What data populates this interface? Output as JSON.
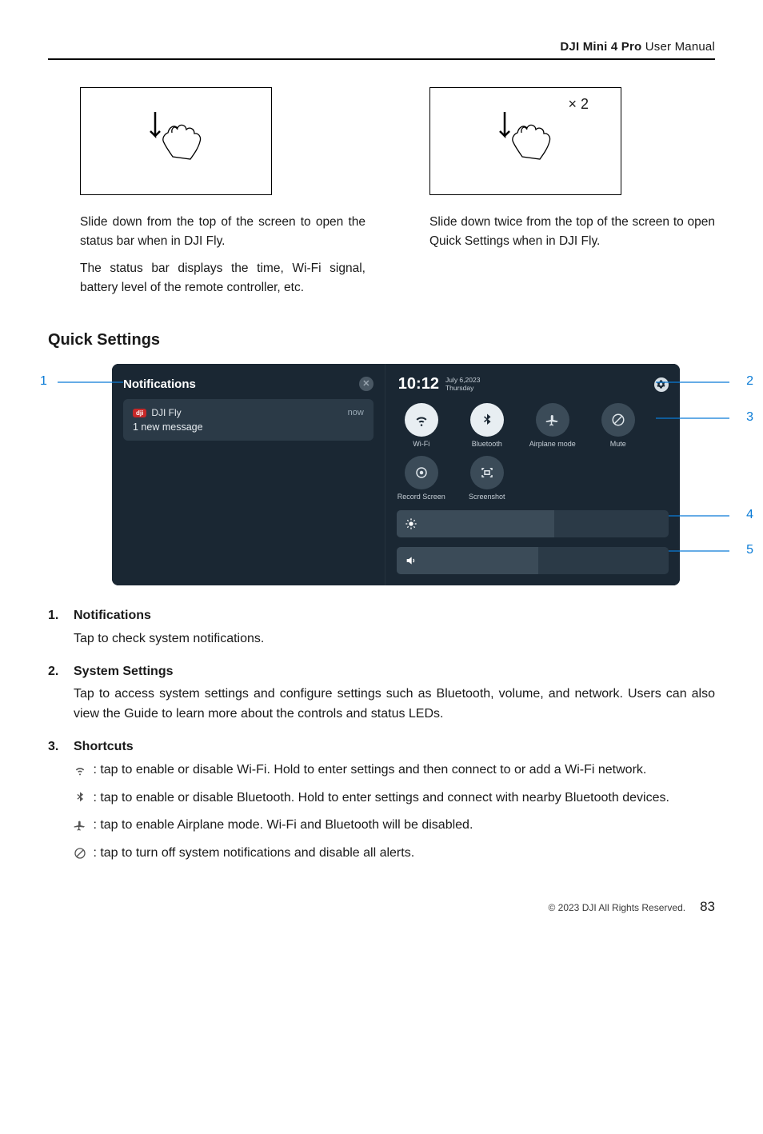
{
  "header": {
    "product": "DJI Mini 4 Pro",
    "suffix": " User Manual"
  },
  "gesture": {
    "left": {
      "p1": "Slide down from the top of the screen to open the status bar when in DJI Fly.",
      "p2": "The status bar displays the time, Wi-Fi signal, battery level of the remote controller, etc."
    },
    "right": {
      "x2": "× 2",
      "p1": "Slide down twice from the top of the screen to open Quick Settings when in DJI Fly."
    }
  },
  "section_title": "Quick Settings",
  "qs": {
    "notif_header": "Notifications",
    "notif_app": "DJI Fly",
    "notif_time": "now",
    "notif_msg": "1 new message",
    "time": "10:12",
    "date_line1": "July 6,2023",
    "date_line2": "Thursday",
    "toggles": {
      "wifi": "Wi-Fi",
      "bt": "Bluetooth",
      "air": "Airplane mode",
      "mute": "Mute",
      "rec": "Record Screen",
      "shot": "Screenshot"
    }
  },
  "callouts": {
    "c1": "1",
    "c2": "2",
    "c3": "3",
    "c4": "4",
    "c5": "5"
  },
  "items": [
    {
      "n": "1.",
      "title": "Notifications",
      "desc": "Tap to check system notifications."
    },
    {
      "n": "2.",
      "title": "System Settings",
      "desc": "Tap to access system settings and configure settings such as Bluetooth, volume, and network. Users can also view the Guide to learn more about the controls and status LEDs."
    },
    {
      "n": "3.",
      "title": "Shortcuts",
      "wifi": " : tap to enable or disable Wi-Fi. Hold to enter settings and then connect to or add a Wi-Fi network.",
      "bt": " : tap to enable or disable Bluetooth. Hold to enter settings and connect with nearby Bluetooth devices.",
      "air": " : tap to enable Airplane mode. Wi-Fi and Bluetooth will be disabled.",
      "mute": " : tap to turn off system notifications and disable all alerts."
    }
  ],
  "footer": {
    "copyright": "© 2023 DJI All Rights Reserved.",
    "page": "83"
  }
}
